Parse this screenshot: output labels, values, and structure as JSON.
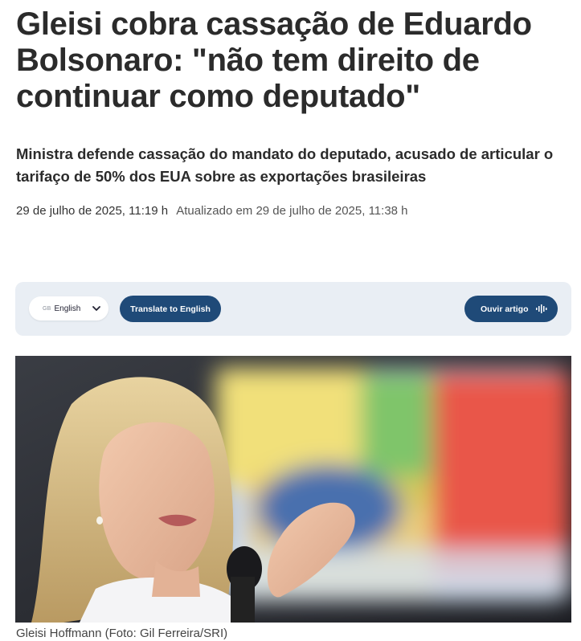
{
  "article": {
    "headline": "Gleisi cobra cassação de Eduardo Bolsonaro: \"não tem direito de continuar como deputado\"",
    "subtitle": "Ministra defende cassação do mandato do deputado, acusado de articular o tarifaço de 50% dos EUA sobre as exportações brasileiras",
    "published": "29 de julho de 2025, 11:19 h",
    "updated": "Atualizado em 29 de julho de 2025, 11:38 h"
  },
  "toolbar": {
    "language_flag": "GB",
    "language_selected": "English",
    "translate_label": "Translate to English",
    "listen_label": "Ouvir artigo",
    "accent_color": "#1f4a78",
    "background_color": "#e9eef4"
  },
  "photo": {
    "caption": "Gleisi Hoffmann (Foto: Gil Ferreira/SRI)"
  }
}
